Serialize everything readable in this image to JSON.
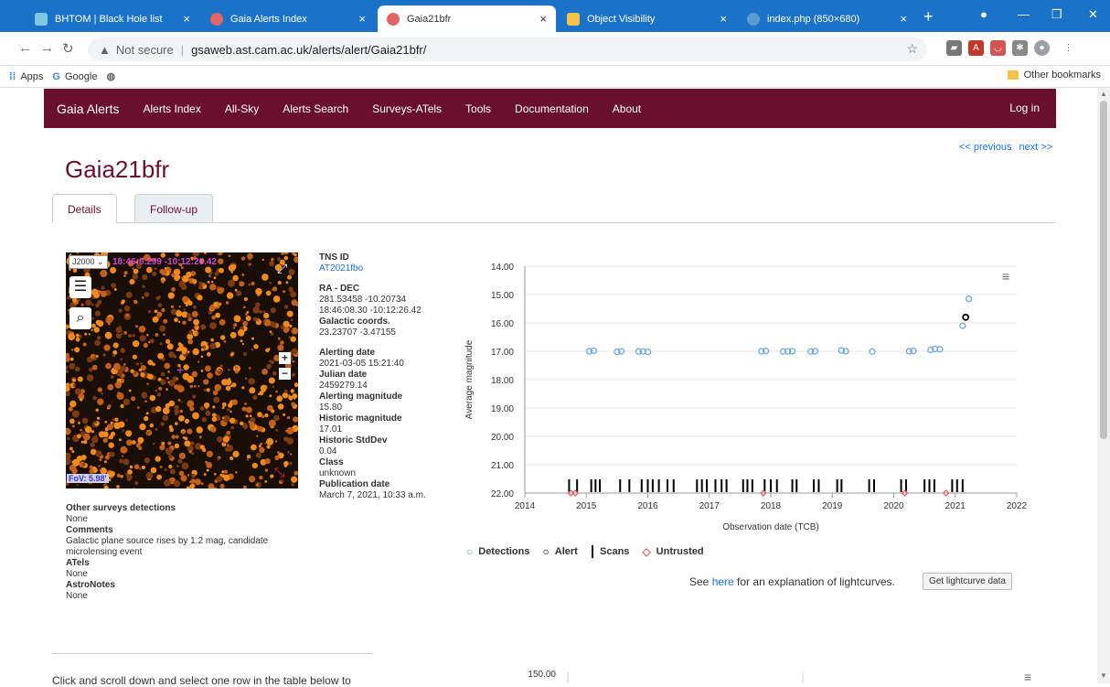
{
  "browser": {
    "tabs": [
      {
        "title": "BHTOM | Black Hole list",
        "active": false
      },
      {
        "title": "Gaia Alerts Index",
        "active": false
      },
      {
        "title": "Gaia21bfr",
        "active": true
      },
      {
        "title": "Object Visibility",
        "active": false
      },
      {
        "title": "index.php (850×680)",
        "active": false
      }
    ],
    "address": {
      "security": "Not secure",
      "url": "gsaweb.ast.cam.ac.uk/alerts/alert/Gaia21bfr/"
    },
    "bookmarks": [
      "Apps",
      "Google"
    ],
    "other_bookmarks": "Other bookmarks"
  },
  "site": {
    "brand": "Gaia Alerts",
    "nav": [
      "Alerts Index",
      "All-Sky",
      "Alerts Search",
      "Surveys-ATels",
      "Tools",
      "Documentation",
      "About"
    ],
    "login": "Log in",
    "prev": "<< previous",
    "next": "next >>"
  },
  "page": {
    "title": "Gaia21bfr",
    "tabs": [
      "Details",
      "Follow-up"
    ]
  },
  "sky": {
    "frame": "J2000",
    "coords": "18:46:8.299 -10:12:26.42",
    "fov": "FoV: 5.98'"
  },
  "details": {
    "tns_id_label": "TNS ID",
    "tns_id": "AT2021fbo",
    "radec_label": "RA - DEC",
    "radec_deg": "281.53458  -10.20734",
    "radec_sex": "18:46:08.30  -10:12:26.42",
    "gal_label": "Galactic coords.",
    "gal": "23.23707  -3.47155",
    "alert_date_label": "Alerting date",
    "alert_date": "2021-03-05 15:21:40",
    "jd_label": "Julian date",
    "jd": "2459279.14",
    "alert_mag_label": "Alerting magnitude",
    "alert_mag": "15.80",
    "hist_mag_label": "Historic magnitude",
    "hist_mag": "17.01",
    "hist_std_label": "Historic StdDev",
    "hist_std": "0.04",
    "class_label": "Class",
    "class": "unknown",
    "pub_label": "Publication date",
    "pub": "March 7, 2021, 10:33 a.m."
  },
  "left": {
    "other_label": "Other surveys detections",
    "other": "None",
    "comments_label": "Comments",
    "comments": "Galactic plane source rises by 1.2 mag, candidate microlensing event",
    "atels_label": "ATels",
    "atels": "None",
    "astronotes_label": "AstroNotes",
    "astronotes": "None"
  },
  "chart_data": {
    "type": "scatter",
    "xlabel": "Observation date (TCB)",
    "ylabel": "Average magnitude",
    "xlim": [
      2014,
      2022
    ],
    "ylim": [
      22.0,
      14.0
    ],
    "y_inverted": true,
    "yticks": [
      "14.00",
      "15.00",
      "16.00",
      "17.00",
      "18.00",
      "19.00",
      "20.00",
      "21.00",
      "22.00"
    ],
    "xticks": [
      "2014",
      "2015",
      "2016",
      "2017",
      "2018",
      "2019",
      "2020",
      "2021",
      "2022"
    ],
    "series": [
      {
        "name": "Detections",
        "color": "#6fa8dc",
        "x": [
          2015.05,
          2015.12,
          2015.5,
          2015.57,
          2015.85,
          2015.92,
          2016.0,
          2017.85,
          2017.92,
          2018.2,
          2018.28,
          2018.35,
          2018.65,
          2018.72,
          2019.15,
          2019.22,
          2019.65,
          2020.25,
          2020.32,
          2020.6,
          2020.67,
          2020.75,
          2021.12,
          2021.22
        ],
        "y": [
          17.0,
          16.98,
          17.02,
          17.0,
          17.01,
          17.0,
          17.02,
          17.0,
          16.99,
          17.01,
          17.0,
          17.0,
          17.01,
          17.0,
          16.97,
          17.0,
          17.01,
          17.0,
          16.99,
          16.95,
          16.92,
          16.93,
          16.1,
          15.15
        ]
      },
      {
        "name": "Alert",
        "color": "#000000",
        "x": [
          2021.17
        ],
        "y": [
          15.8
        ]
      },
      {
        "name": "Scans",
        "color": "#000000",
        "x": [
          2014.72,
          2014.85,
          2015.08,
          2015.15,
          2015.22,
          2015.55,
          2015.7,
          2015.9,
          2016.0,
          2016.08,
          2016.18,
          2016.32,
          2016.42,
          2016.8,
          2016.88,
          2016.96,
          2017.1,
          2017.2,
          2017.28,
          2017.55,
          2017.62,
          2017.7,
          2017.9,
          2018.0,
          2018.1,
          2018.35,
          2018.42,
          2018.7,
          2018.78,
          2019.08,
          2019.15,
          2019.6,
          2019.68,
          2020.12,
          2020.2,
          2020.5,
          2020.58,
          2020.66,
          2020.95,
          2021.03,
          2021.12
        ]
      },
      {
        "name": "Untrusted",
        "color": "#e06666",
        "x": [
          2014.75,
          2014.82,
          2017.88,
          2020.18,
          2020.85
        ],
        "y": [
          22.0,
          22.0,
          22.0,
          22.0,
          22.0
        ]
      }
    ]
  },
  "legend": [
    "Detections",
    "Alert",
    "Scans",
    "Untrusted"
  ],
  "explain": {
    "pre": "See ",
    "link": "here",
    "post": " for an explanation of lightcurves."
  },
  "get_button": "Get lightcurve data",
  "bottom": {
    "text": "Click and scroll down and select one row in the table below to",
    "chart2_ytick": "150.00"
  }
}
